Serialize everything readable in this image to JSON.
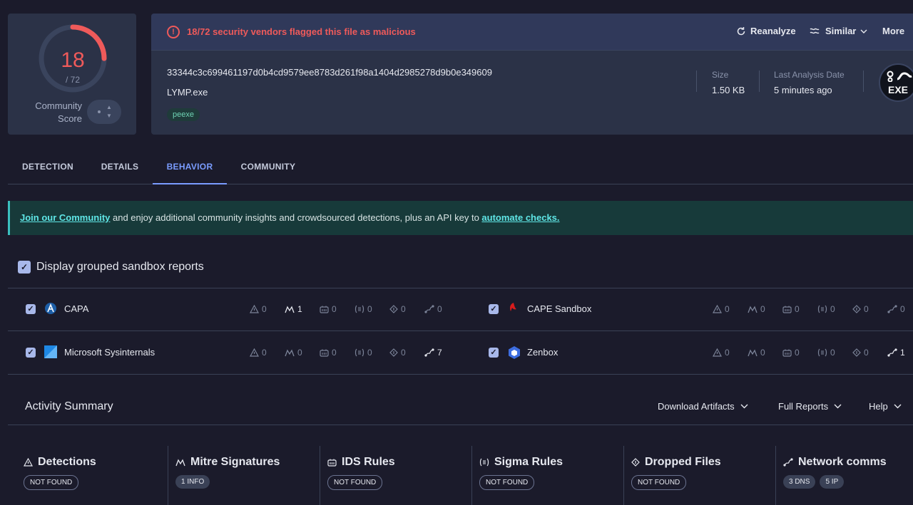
{
  "score": {
    "detected": "18",
    "total": "/ 72",
    "community_label_1": "Community",
    "community_label_2": "Score",
    "ring_fraction": 0.25
  },
  "file": {
    "flag_text": "18/72 security vendors flagged this file as malicious",
    "actions": {
      "reanalyze": "Reanalyze",
      "similar": "Similar",
      "more": "More"
    },
    "hash": "33344c3c699461197d0b4cd9579ee8783d261f98a1404d2985278d9b0e349609",
    "name": "LYMP.exe",
    "tag": "peexe",
    "size_label": "Size",
    "size_value": "1.50 KB",
    "last_label": "Last Analysis Date",
    "last_value": "5 minutes ago",
    "type_badge": "EXE"
  },
  "tabs": [
    {
      "label": "DETECTION"
    },
    {
      "label": "DETAILS"
    },
    {
      "label": "BEHAVIOR"
    },
    {
      "label": "COMMUNITY"
    }
  ],
  "banner": {
    "join": "Join our Community",
    "middle": " and enjoy additional community insights and crowdsourced detections, plus an API key to ",
    "automate": "automate checks."
  },
  "group_toggle": {
    "label": "Display grouped sandbox reports",
    "checked": true
  },
  "sandboxes": [
    {
      "name": "CAPA",
      "stats": [
        "0",
        "1",
        "0",
        "0",
        "0",
        "0"
      ]
    },
    {
      "name": "CAPE Sandbox",
      "stats": [
        "0",
        "0",
        "0",
        "0",
        "0",
        "0"
      ]
    },
    {
      "name": "Microsoft Sysinternals",
      "stats": [
        "0",
        "0",
        "0",
        "0",
        "0",
        "7"
      ]
    },
    {
      "name": "Zenbox",
      "stats": [
        "0",
        "0",
        "0",
        "0",
        "0",
        "1"
      ]
    }
  ],
  "activity": {
    "title": "Activity Summary",
    "download": "Download Artifacts",
    "full_reports": "Full Reports",
    "help": "Help"
  },
  "summary": [
    {
      "title": "Detections",
      "badges": [
        "NOT FOUND"
      ]
    },
    {
      "title": "Mitre Signatures",
      "badges": [
        "1 INFO"
      ]
    },
    {
      "title": "IDS Rules",
      "badges": [
        "NOT FOUND"
      ]
    },
    {
      "title": "Sigma Rules",
      "badges": [
        "NOT FOUND"
      ]
    },
    {
      "title": "Dropped Files",
      "badges": [
        "NOT FOUND"
      ]
    },
    {
      "title": "Network comms",
      "badges": [
        "3 DNS",
        "5 IP"
      ]
    }
  ],
  "colors": {
    "malicious": "#ef5a5a",
    "accent": "#7a9cff",
    "banner_link": "#5fe6e6"
  }
}
